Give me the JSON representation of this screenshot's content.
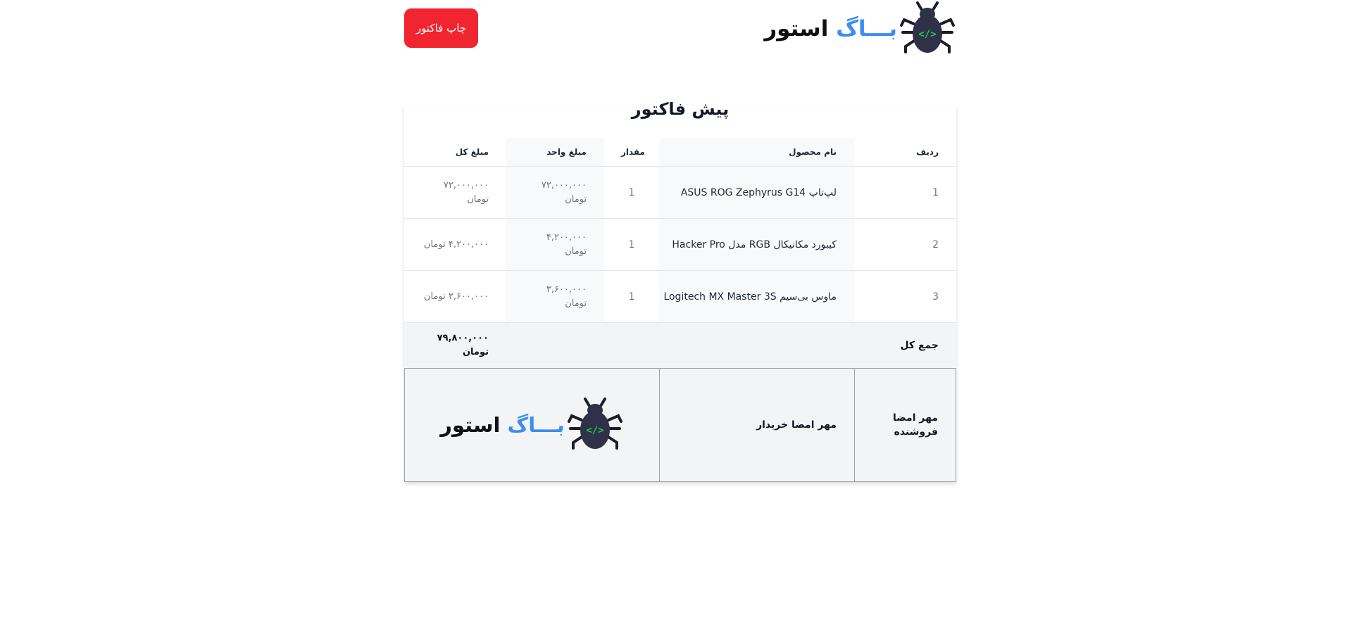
{
  "header": {
    "print_button": "چاپ فاکتور",
    "logo_bag": "بـــاگ",
    "logo_store": "استور"
  },
  "invoice": {
    "title": "پیش فاکتور",
    "columns": [
      "ردیف",
      "نام محصول",
      "مقدار",
      "مبلغ واحد",
      "مبلغ کل"
    ],
    "rows": [
      {
        "idx": "1",
        "name": "لپ‌تاپ ASUS ROG Zephyrus G14",
        "qty": "1",
        "unit": "۷۲,۰۰۰,۰۰۰ تومان",
        "total": "۷۲,۰۰۰,۰۰۰ تومان"
      },
      {
        "idx": "2",
        "name": "کیبورد مکانیکال RGB مدل Hacker Pro",
        "qty": "1",
        "unit": "۴,۲۰۰,۰۰۰ تومان",
        "total": "۴,۲۰۰,۰۰۰ تومان"
      },
      {
        "idx": "3",
        "name": "ماوس بی‌سیم Logitech MX Master 3S",
        "qty": "1",
        "unit": "۳,۶۰۰,۰۰۰ تومان",
        "total": "۳,۶۰۰,۰۰۰ تومان"
      }
    ],
    "total_label": "جمع کل",
    "total_value": "۷۹,۸۰۰,۰۰۰ تومان"
  },
  "signatures": {
    "seller": "مهر امضا فروشنده",
    "buyer": "مهر امضا خریدار"
  },
  "colors": {
    "accent_red": "#f0252f",
    "logo_blue": "#3b8ef0",
    "bug_body": "#2f3146",
    "code_green": "#22c55e"
  }
}
